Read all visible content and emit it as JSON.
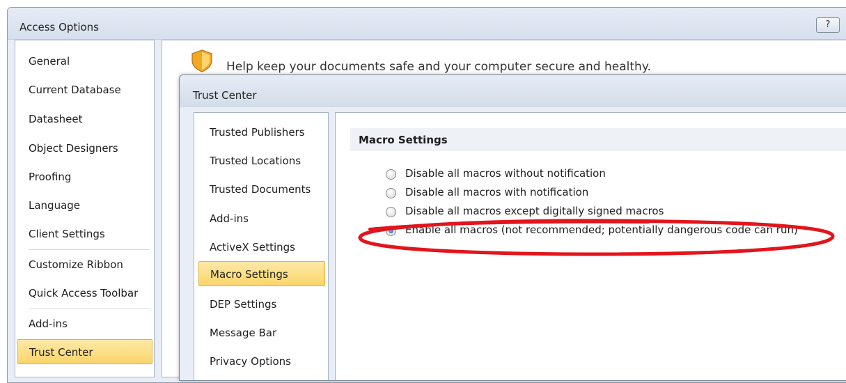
{
  "access": {
    "title": "Access Options",
    "help_label": "?",
    "help_text": "Help keep your documents safe and your computer secure and healthy.",
    "nav": [
      {
        "label": "General"
      },
      {
        "label": "Current Database"
      },
      {
        "label": "Datasheet"
      },
      {
        "label": "Object Designers"
      },
      {
        "label": "Proofing"
      },
      {
        "label": "Language"
      },
      {
        "label": "Client Settings"
      },
      {
        "label": "Customize Ribbon"
      },
      {
        "label": "Quick Access Toolbar"
      },
      {
        "label": "Add-ins"
      },
      {
        "label": "Trust Center",
        "active": true
      }
    ]
  },
  "trust_center": {
    "title": "Trust Center",
    "nav": [
      {
        "label": "Trusted Publishers"
      },
      {
        "label": "Trusted Locations"
      },
      {
        "label": "Trusted Documents"
      },
      {
        "label": "Add-ins"
      },
      {
        "label": "ActiveX Settings"
      },
      {
        "label": "Macro Settings",
        "active": true
      },
      {
        "label": "DEP Settings"
      },
      {
        "label": "Message Bar"
      },
      {
        "label": "Privacy Options"
      }
    ],
    "section_title": "Macro Settings",
    "options": [
      {
        "label": "Disable all macros without notification",
        "checked": false
      },
      {
        "label": "Disable all macros with notification",
        "checked": false
      },
      {
        "label": "Disable all macros except digitally signed macros",
        "checked": false
      },
      {
        "label": "Enable all macros (not recommended; potentially dangerous code can run)",
        "checked": true
      }
    ]
  },
  "annotation_color": "#e3141b",
  "accent": {
    "selected_fill": "#fbd56b",
    "selected_border": "#e2b43c"
  }
}
